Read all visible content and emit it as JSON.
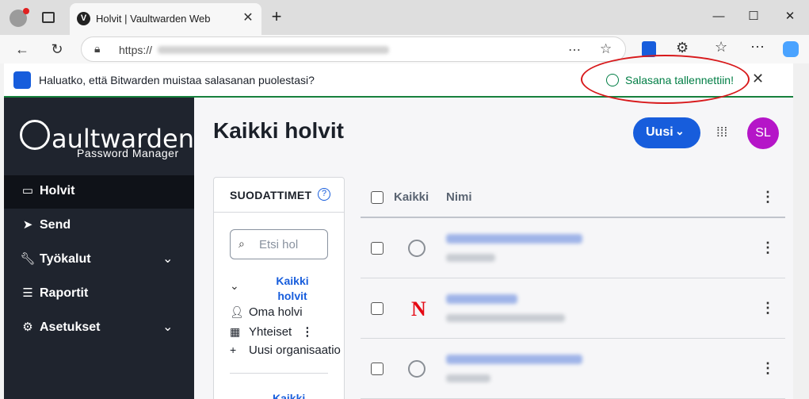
{
  "browser": {
    "tab_title": "Holvit | Vaultwarden Web",
    "tab_favicon": "vaultwarden-icon",
    "new_tab": "+",
    "url_prefix": "https://",
    "window_controls": [
      "—",
      "☐",
      "✕"
    ]
  },
  "save_bar": {
    "message": "Haluatko, että Bitwarden muistaa salasanan puolestasi?",
    "confirmation": "Salasana tallennettiin!",
    "accent_color": "#017e45",
    "highlight_color": "#d8191b"
  },
  "sidebar": {
    "logo": "Vaultwarden",
    "logo_sub": "Password Manager",
    "items": [
      {
        "label": "Holvit",
        "icon": "vault-icon",
        "active": true
      },
      {
        "label": "Send",
        "icon": "send-icon"
      },
      {
        "label": "Työkalut",
        "icon": "wrench-icon",
        "expandable": true
      },
      {
        "label": "Raportit",
        "icon": "sliders-icon"
      },
      {
        "label": "Asetukset",
        "icon": "gear-icon",
        "expandable": true
      }
    ]
  },
  "main": {
    "title": "Kaikki holvit",
    "new_button": "Uusi",
    "avatar_initials": "SL",
    "avatar_color": "#b515c8",
    "brand_color": "#175ddc"
  },
  "filters": {
    "title": "SUODATTIMET",
    "search_placeholder": "Etsi hol",
    "all_vaults": "Kaikki holvit",
    "rows": [
      {
        "label": "Oma holvi",
        "icon": "person-icon"
      },
      {
        "label": "Yhteiset",
        "icon": "building-icon"
      },
      {
        "label": "Uusi organisaatio",
        "icon": "plus-icon"
      }
    ],
    "all_bottom": "Kaikki"
  },
  "table": {
    "col_all": "Kaikki",
    "col_name": "Nimi"
  }
}
